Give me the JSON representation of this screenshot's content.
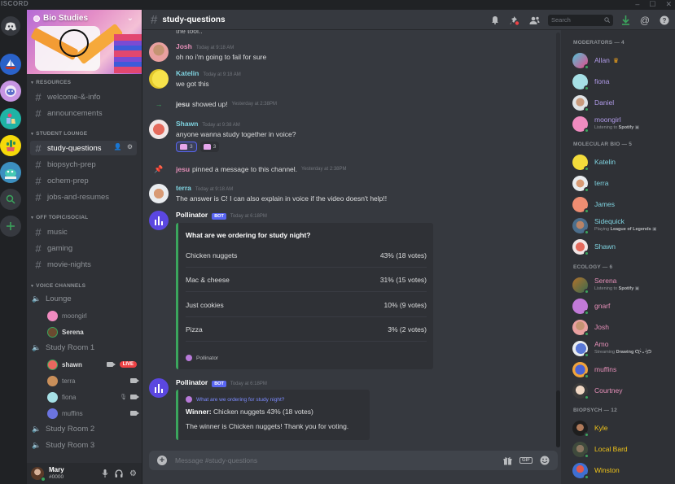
{
  "app": {
    "brand": "ISCORD",
    "window_controls": [
      "–",
      "☐",
      "✕"
    ]
  },
  "colors": {
    "accent": "#5865f2",
    "online": "#3ba55d",
    "live": "#ed4245",
    "moderator": "#b09ae8",
    "molecular_bio": "#7fd3e0",
    "ecology": "#e58fb8",
    "biopsych": "#f0c419"
  },
  "servers": [
    {
      "name": "home",
      "icon": "discord-logo-icon"
    },
    {
      "name": "server-boat",
      "icon": "sailboat-icon"
    },
    {
      "name": "server-astronaut",
      "icon": "astronaut-icon"
    },
    {
      "name": "server-shopping",
      "icon": "shopping-bag-icon"
    },
    {
      "name": "server-cactus",
      "icon": "cactus-icon"
    },
    {
      "name": "server-creature",
      "icon": "creature-icon"
    },
    {
      "name": "explore",
      "icon": "search-icon"
    },
    {
      "name": "add-server",
      "icon": "plus-icon"
    }
  ],
  "guild": {
    "name": "Bio Studies"
  },
  "categories": {
    "resources": "RESOURCES",
    "student_lounge": "STUDENT LOUNGE",
    "off_topic": "OFF TOPIC/SOCIAL",
    "voice": "VOICE CHANNELS"
  },
  "channels": {
    "resources": [
      "welcome-&-info",
      "announcements"
    ],
    "student_lounge": [
      "study-questions",
      "biopsych-prep",
      "ochem-prep",
      "jobs-and-resumes"
    ],
    "off_topic": [
      "music",
      "gaming",
      "movie-nights"
    ]
  },
  "voice": {
    "lounge": {
      "name": "Lounge",
      "users": [
        "moongirl",
        "Serena"
      ]
    },
    "study_room_1": {
      "name": "Study Room 1",
      "users": [
        "shawn",
        "terra",
        "fiona",
        "muffins"
      ],
      "live_label": "LIVE"
    },
    "study_room_2": {
      "name": "Study Room 2"
    },
    "study_room_3": {
      "name": "Study Room 3"
    }
  },
  "user": {
    "name": "Mary",
    "tag": "#0000"
  },
  "header": {
    "channel": "study-questions",
    "search_placeholder": "Search"
  },
  "messages": {
    "cut_text": "the tool..",
    "josh": {
      "author": "Josh",
      "time": "Today at 9:18 AM",
      "text": "oh no i'm going to fail for sure"
    },
    "katelin": {
      "author": "Katelin",
      "time": "Today at 9:18 AM",
      "text": "we got this"
    },
    "join": {
      "who": "jesu",
      "text": "showed up!",
      "time": "Yesterday at 2:38PM"
    },
    "shawn": {
      "author": "Shawn",
      "time": "Today at 9:38 AM",
      "text": "anyone wanna study together in voice?",
      "reactions": [
        "3",
        "3"
      ]
    },
    "pin": {
      "who": "jesu",
      "text": "pinned a message to this channel.",
      "time": "Yesterday at 2:38PM"
    },
    "terra": {
      "author": "terra",
      "time": "Today at 9:18 AM",
      "text": "The answer is C! I can also explain in voice if the video doesn't help!!"
    },
    "poll": {
      "author": "Pollinator",
      "badge": "BOT",
      "time": "Today at 6:18PM",
      "question": "What are we ordering for study night?",
      "options": [
        {
          "label": "Chicken nuggets",
          "result": "43% (18 votes)"
        },
        {
          "label": "Mac & cheese",
          "result": "31% (15 votes)"
        },
        {
          "label": "Just cookies",
          "result": "10% (9 votes)"
        },
        {
          "label": "Pizza",
          "result": "3% (2 votes)"
        }
      ],
      "footer": "Pollinator"
    },
    "result": {
      "author": "Pollinator",
      "badge": "BOT",
      "time": "Today at 6:18PM",
      "question": "What are we ordering for study night?",
      "winner_label": "Winner:",
      "winner_text": "Chicken nuggets 43% (18 votes)",
      "thanks": "The winner is Chicken nuggets! Thank you for voting."
    }
  },
  "composer": {
    "placeholder": "Message #study-questions",
    "gif": "GIF"
  },
  "members": {
    "moderators": {
      "title": "MODERATORS — 4",
      "list": [
        {
          "name": "Allan"
        },
        {
          "name": "fiona"
        },
        {
          "name": "Daniel"
        },
        {
          "name": "moongirl",
          "activity_prefix": "Listening to",
          "activity": "Spotify"
        }
      ]
    },
    "molecular_bio": {
      "title": "MOLECULAR BIO — 5",
      "list": [
        {
          "name": "Katelin"
        },
        {
          "name": "terra"
        },
        {
          "name": "James"
        },
        {
          "name": "Sidequick",
          "activity_prefix": "Playing",
          "activity": "League of Legends"
        },
        {
          "name": "Shawn"
        }
      ]
    },
    "ecology": {
      "title": "ECOLOGY — 6",
      "list": [
        {
          "name": "Serena",
          "activity_prefix": "Listening to",
          "activity": "Spotify"
        },
        {
          "name": "gnarf"
        },
        {
          "name": "Josh"
        },
        {
          "name": "Amo",
          "activity_prefix": "Streaming",
          "activity": "Drawing ᕦ(•̀⌄•́)ᕤ"
        },
        {
          "name": "muffins"
        },
        {
          "name": "Courtney"
        }
      ]
    },
    "biopsych": {
      "title": "BIOPSYCH — 12",
      "list": [
        {
          "name": "Kyle"
        },
        {
          "name": "Local Bard"
        },
        {
          "name": "Winston"
        }
      ]
    }
  }
}
